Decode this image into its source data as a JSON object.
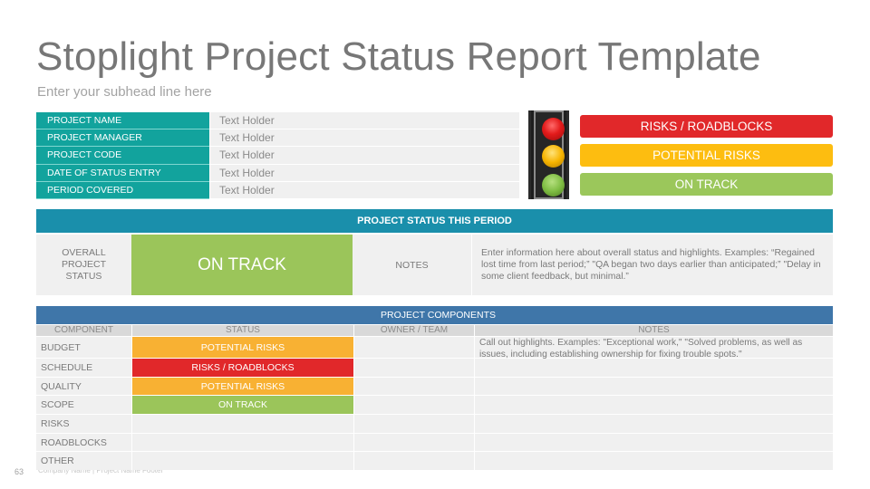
{
  "header": {
    "title": "Stoplight Project Status Report Template",
    "subhead": "Enter your subhead line here"
  },
  "project_info": [
    {
      "label": "PROJECT NAME",
      "value": "Text Holder"
    },
    {
      "label": "PROJECT MANAGER",
      "value": "Text Holder"
    },
    {
      "label": "PROJECT CODE",
      "value": "Text Holder"
    },
    {
      "label": "DATE OF STATUS ENTRY",
      "value": "Text Holder"
    },
    {
      "label": "PERIOD COVERED",
      "value": "Text Holder"
    }
  ],
  "stoplight": {
    "icon": "traffic-light-icon",
    "lamps": [
      "red",
      "yellow",
      "green"
    ]
  },
  "legend": [
    {
      "label": "RISKS / ROADBLOCKS",
      "color": "#e1282a"
    },
    {
      "label": "POTENTIAL RISKS",
      "color": "#fdbd10"
    },
    {
      "label": "ON TRACK",
      "color": "#9bc75b"
    }
  ],
  "status_period": {
    "heading": "PROJECT STATUS THIS PERIOD",
    "overall_label": "OVERALL PROJECT STATUS",
    "overall_lines": [
      "OVERALL",
      "PROJECT",
      "STATUS"
    ],
    "overall_value": "ON TRACK",
    "notes_label": "NOTES",
    "notes_lines": [
      "Enter information here about overall status and highlights. Examples: “Regained",
      "lost time from last period;” \"QA began two days earlier than anticipated;” \"Delay in",
      "some client feedback, but minimal.”"
    ]
  },
  "components": {
    "heading": "PROJECT COMPONENTS",
    "columns": [
      "COMPONENT",
      "STATUS",
      "OWNER / TEAM",
      "NOTES"
    ],
    "rows": [
      {
        "component": "BUDGET",
        "status": "POTENTIAL RISKS",
        "status_type": "potential",
        "owner": "",
        "notes_lines": [
          "Call out highlights. Examples: \"Exceptional work,\" \"Solved problems, as well as",
          "issues, including establishing ownership for fixing trouble spots.\""
        ]
      },
      {
        "component": "SCHEDULE",
        "status": "RISKS / ROADBLOCKS",
        "status_type": "risks",
        "owner": "",
        "notes_lines": []
      },
      {
        "component": "QUALITY",
        "status": "POTENTIAL RISKS",
        "status_type": "potential",
        "owner": "",
        "notes_lines": []
      },
      {
        "component": "SCOPE",
        "status": "ON TRACK",
        "status_type": "ontrack",
        "owner": "",
        "notes_lines": []
      },
      {
        "component": "RISKS",
        "status": "",
        "status_type": "",
        "owner": "",
        "notes_lines": []
      },
      {
        "component": "ROADBLOCKS",
        "status": "",
        "status_type": "",
        "owner": "",
        "notes_lines": []
      },
      {
        "component": "OTHER",
        "status": "",
        "status_type": "",
        "owner": "",
        "notes_lines": []
      }
    ]
  },
  "footer": {
    "page_number": "63",
    "text": "Company Name | Project Name Footer"
  }
}
